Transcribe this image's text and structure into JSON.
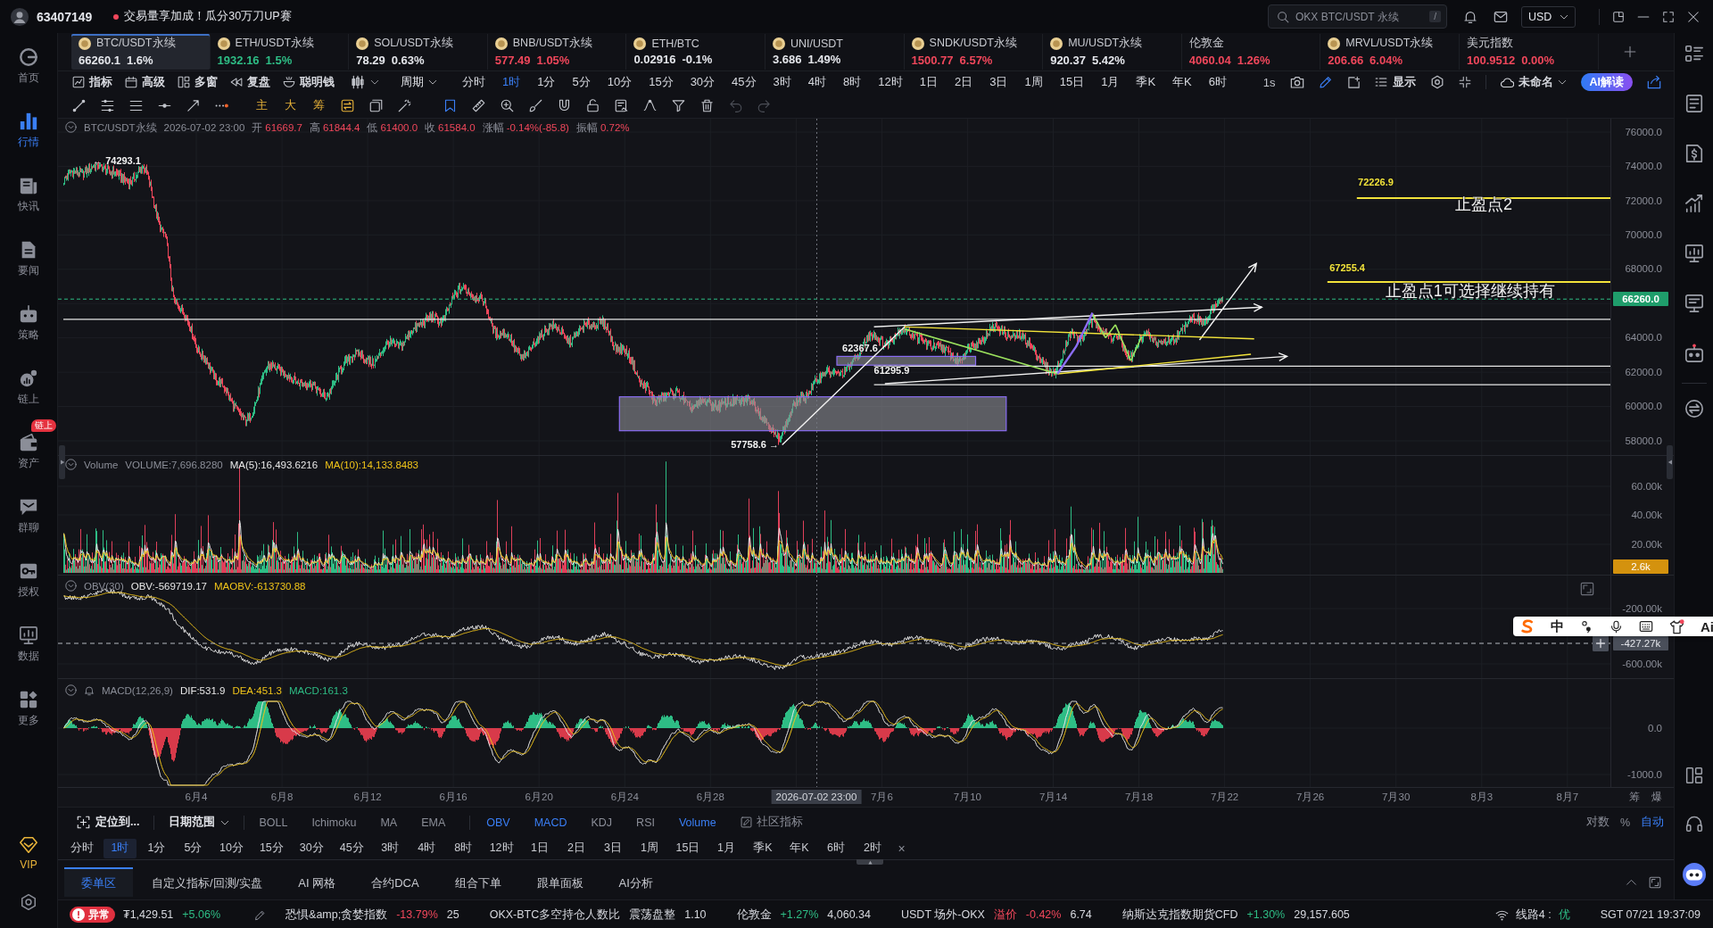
{
  "top_bar": {
    "account_id": "63407149",
    "promo": "交易量享加成！瓜分30万刀UP赛",
    "search": {
      "placeholder": "OKX BTC/USDT 永续",
      "shortcut": "/"
    },
    "currency": "USD"
  },
  "sidebar": {
    "items": [
      {
        "label": "首页",
        "selected": false
      },
      {
        "label": "行情",
        "selected": true
      },
      {
        "label": "快讯",
        "selected": false
      },
      {
        "label": "要闻",
        "selected": false
      },
      {
        "label": "策略",
        "selected": false
      },
      {
        "label": "链上",
        "selected": false
      },
      {
        "label": "资产",
        "selected": false,
        "badge": "链上"
      },
      {
        "label": "群聊",
        "selected": false
      },
      {
        "label": "授权",
        "selected": false
      },
      {
        "label": "数据",
        "selected": false
      },
      {
        "label": "更多",
        "selected": false
      }
    ],
    "vip": "VIP"
  },
  "tickers": [
    {
      "symbol": "BTC/USDT永续",
      "price": "66260.1",
      "change": "1.6%",
      "color": "#e4e6eb",
      "has_icon": true,
      "selected": true
    },
    {
      "symbol": "ETH/USDT永续",
      "price": "1932.16",
      "change": "1.5%",
      "color": "#2ebd85",
      "has_icon": true,
      "selected": false
    },
    {
      "symbol": "SOL/USDT永续",
      "price": "78.29",
      "change": "0.63%",
      "color": "#e4e6eb",
      "has_icon": true,
      "selected": false
    },
    {
      "symbol": "BNB/USDT永续",
      "price": "577.49",
      "change": "1.05%",
      "color": "#f0475b",
      "has_icon": true,
      "selected": false
    },
    {
      "symbol": "ETH/BTC",
      "price": "0.02916",
      "change": "-0.1%",
      "color": "#e4e6eb",
      "has_icon": true,
      "selected": false
    },
    {
      "symbol": "UNI/USDT",
      "price": "3.686",
      "change": "1.49%",
      "color": "#e4e6eb",
      "has_icon": true,
      "selected": false
    },
    {
      "symbol": "SNDK/USDT永续",
      "price": "1500.77",
      "change": "6.57%",
      "color": "#f0475b",
      "has_icon": true,
      "selected": false
    },
    {
      "symbol": "MU/USDT永续",
      "price": "920.37",
      "change": "5.42%",
      "color": "#e4e6eb",
      "has_icon": true,
      "selected": false
    },
    {
      "symbol": "伦敦金",
      "price": "4060.04",
      "change": "1.26%",
      "color": "#f0475b",
      "has_icon": false,
      "selected": false
    },
    {
      "symbol": "MRVL/USDT永续",
      "price": "206.66",
      "change": "6.04%",
      "color": "#f0475b",
      "has_icon": true,
      "selected": false
    },
    {
      "symbol": "美元指数",
      "price": "100.9512",
      "change": "0.00%",
      "color": "#f0475b",
      "has_icon": false,
      "selected": false
    }
  ],
  "toolbar": {
    "tools": [
      "指标",
      "高级",
      "多窗",
      "复盘",
      "聪明钱"
    ],
    "period_menu": "周期",
    "periods": [
      {
        "label": "分时",
        "selected": false
      },
      {
        "label": "1时",
        "selected": true
      },
      {
        "label": "1分",
        "selected": false
      },
      {
        "label": "5分",
        "selected": false
      },
      {
        "label": "10分",
        "selected": false
      },
      {
        "label": "15分",
        "selected": false
      },
      {
        "label": "30分",
        "selected": false
      },
      {
        "label": "45分",
        "selected": false
      },
      {
        "label": "3时",
        "selected": false
      },
      {
        "label": "4时",
        "selected": false
      },
      {
        "label": "8时",
        "selected": false
      },
      {
        "label": "12时",
        "selected": false
      },
      {
        "label": "1日",
        "selected": false
      },
      {
        "label": "2日",
        "selected": false
      },
      {
        "label": "3日",
        "selected": false
      },
      {
        "label": "1周",
        "selected": false
      },
      {
        "label": "15日",
        "selected": false
      },
      {
        "label": "1月",
        "selected": false
      },
      {
        "label": "季K",
        "selected": false
      },
      {
        "label": "年K",
        "selected": false
      },
      {
        "label": "6时",
        "selected": false
      }
    ],
    "refresh": "1s",
    "display": "显示",
    "layout_name": "未命名",
    "ai_button": "AI解读"
  },
  "drawing_tools": {
    "text_tools": [
      "主",
      "大",
      "筹"
    ]
  },
  "chart": {
    "header": {
      "symbol": "BTC/USDT永续",
      "time": "2026-07-02 23:00",
      "color": "#f0475b",
      "fields": [
        {
          "label": "开",
          "value": "61669.7"
        },
        {
          "label": "高",
          "value": "61844.4"
        },
        {
          "label": "低",
          "value": "61400.0"
        },
        {
          "label": "收",
          "value": "61584.0"
        },
        {
          "label": "涨幅",
          "value": "-0.14%(-85.8)"
        },
        {
          "label": "振幅",
          "value": "0.72%"
        }
      ]
    },
    "price_axis": [
      "76000.0",
      "74000.0",
      "72000.0",
      "70000.0",
      "68000.0",
      "64000.0",
      "62000.0",
      "60000.0",
      "58000.0"
    ],
    "last_price": "66260.0",
    "annotations": [
      {
        "kind": "high",
        "text": "← 74293.1"
      },
      {
        "kind": "low",
        "text": "57758.6 →"
      },
      {
        "kind": "level",
        "text": "62367.6"
      },
      {
        "kind": "level",
        "text": "61295.9"
      },
      {
        "kind": "target",
        "text": "72226.9"
      },
      {
        "kind": "note",
        "text": "止盈点2"
      },
      {
        "kind": "target",
        "text": "67255.4"
      },
      {
        "kind": "note",
        "text": "止盈点1可选择继续持有"
      }
    ]
  },
  "volume": {
    "title": "Volume",
    "readings": [
      {
        "text": "VOLUME:7,696.8280",
        "color": "#8b8e98"
      },
      {
        "text": "MA(5):16,493.6216",
        "color": "#e8e8e8"
      },
      {
        "text": "MA(10):14,133.8483",
        "color": "#f0c419"
      }
    ],
    "axis": [
      "60.00k",
      "40.00k",
      "20.00k"
    ],
    "last_value": "2.6k"
  },
  "obv": {
    "title": "OBV(30)",
    "readings": [
      {
        "text": "OBV:-569719.17",
        "color": "#e8e8e8"
      },
      {
        "text": "MAOBV:-613730.88",
        "color": "#f0c419"
      }
    ],
    "axis": [
      "-200.00k",
      "-600.00k"
    ],
    "cursor_value": "-427.27k"
  },
  "macd": {
    "title": "MACD(12,26,9)",
    "readings": [
      {
        "text": "DIF:531.9",
        "color": "#e8e8e8"
      },
      {
        "text": "DEA:451.3",
        "color": "#f0c419"
      },
      {
        "text": "MACD:161.3",
        "color": "#2ebd85"
      }
    ],
    "axis": [
      "0.0",
      "-1000.0"
    ]
  },
  "time_axis": {
    "labels": [
      "6月4",
      "6月8",
      "6月12",
      "6月16",
      "6月20",
      "6月24",
      "6月28",
      "7月6",
      "7月10",
      "7月14",
      "7月18",
      "7月22",
      "7月26",
      "7月30",
      "8月3",
      "8月7"
    ],
    "cursor": "2026-07-02 23:00",
    "side_labels": [
      "筹",
      "爆"
    ]
  },
  "indicator_bar": {
    "locate": "定位到...",
    "date_range": "日期范围",
    "overlay_indicators": [
      {
        "label": "BOLL",
        "on": false
      },
      {
        "label": "Ichimoku",
        "on": false
      },
      {
        "label": "MA",
        "on": false
      },
      {
        "label": "EMA",
        "on": false
      }
    ],
    "pane_indicators": [
      {
        "label": "OBV",
        "on": true
      },
      {
        "label": "MACD",
        "on": true
      },
      {
        "label": "KDJ",
        "on": false
      },
      {
        "label": "RSI",
        "on": false
      },
      {
        "label": "Volume",
        "on": true
      }
    ],
    "community": "社区指标",
    "scale_modes": [
      {
        "label": "对数",
        "selected": false
      },
      {
        "label": "%",
        "selected": false
      },
      {
        "label": "自动",
        "selected": true
      }
    ]
  },
  "period_bar": {
    "periods": [
      {
        "label": "分时",
        "selected": false
      },
      {
        "label": "1时",
        "selected": true
      },
      {
        "label": "1分",
        "selected": false
      },
      {
        "label": "5分",
        "selected": false
      },
      {
        "label": "10分",
        "selected": false
      },
      {
        "label": "15分",
        "selected": false
      },
      {
        "label": "30分",
        "selected": false
      },
      {
        "label": "45分",
        "selected": false
      },
      {
        "label": "3时",
        "selected": false
      },
      {
        "label": "4时",
        "selected": false
      },
      {
        "label": "8时",
        "selected": false
      },
      {
        "label": "12时",
        "selected": false
      },
      {
        "label": "1日",
        "selected": false
      },
      {
        "label": "2日",
        "selected": false
      },
      {
        "label": "3日",
        "selected": false
      },
      {
        "label": "1周",
        "selected": false
      },
      {
        "label": "15日",
        "selected": false
      },
      {
        "label": "1月",
        "selected": false
      },
      {
        "label": "季K",
        "selected": false
      },
      {
        "label": "年K",
        "selected": false
      },
      {
        "label": "6时",
        "selected": false
      },
      {
        "label": "2时",
        "selected": false
      }
    ],
    "close": "×"
  },
  "panel_tabs": [
    {
      "label": "委单区",
      "selected": true
    },
    {
      "label": "自定义指标/回测/实盘",
      "selected": false
    },
    {
      "label": "AI 网格",
      "selected": false
    },
    {
      "label": "合约DCA",
      "selected": false
    },
    {
      "label": "组合下单",
      "selected": false
    },
    {
      "label": "跟单面板",
      "selected": false
    },
    {
      "label": "AI分析",
      "selected": false
    }
  ],
  "status_bar": {
    "alert": "异常",
    "price": "₮1,429.51",
    "change": "+5.06%",
    "color": "#2ebd85",
    "indices": [
      {
        "name": "恐惧&amp;贪婪指数",
        "change": "-13.79%",
        "color": "#f0475b",
        "value": "25"
      },
      {
        "name": "OKX-BTC多空持仓人数比",
        "tag": "震荡盘整",
        "value": "1.10"
      },
      {
        "name": "伦敦金",
        "change": "+1.27%",
        "color": "#2ebd85",
        "value": "4,060.34"
      },
      {
        "name": "USDT 场外-OKX",
        "tag": "溢价",
        "change": "-0.42%",
        "color": "#f0475b",
        "value": "6.74"
      },
      {
        "name": "纳斯达克指数期货CFD",
        "change": "+1.30%",
        "color": "#2ebd85",
        "value": "29,157.605"
      }
    ],
    "route": "线路4 :",
    "route_quality": "优",
    "clock": "SGT 07/21 19:37:09"
  },
  "ime_toolbar": {
    "mode": "中",
    "ai": "Ai"
  }
}
